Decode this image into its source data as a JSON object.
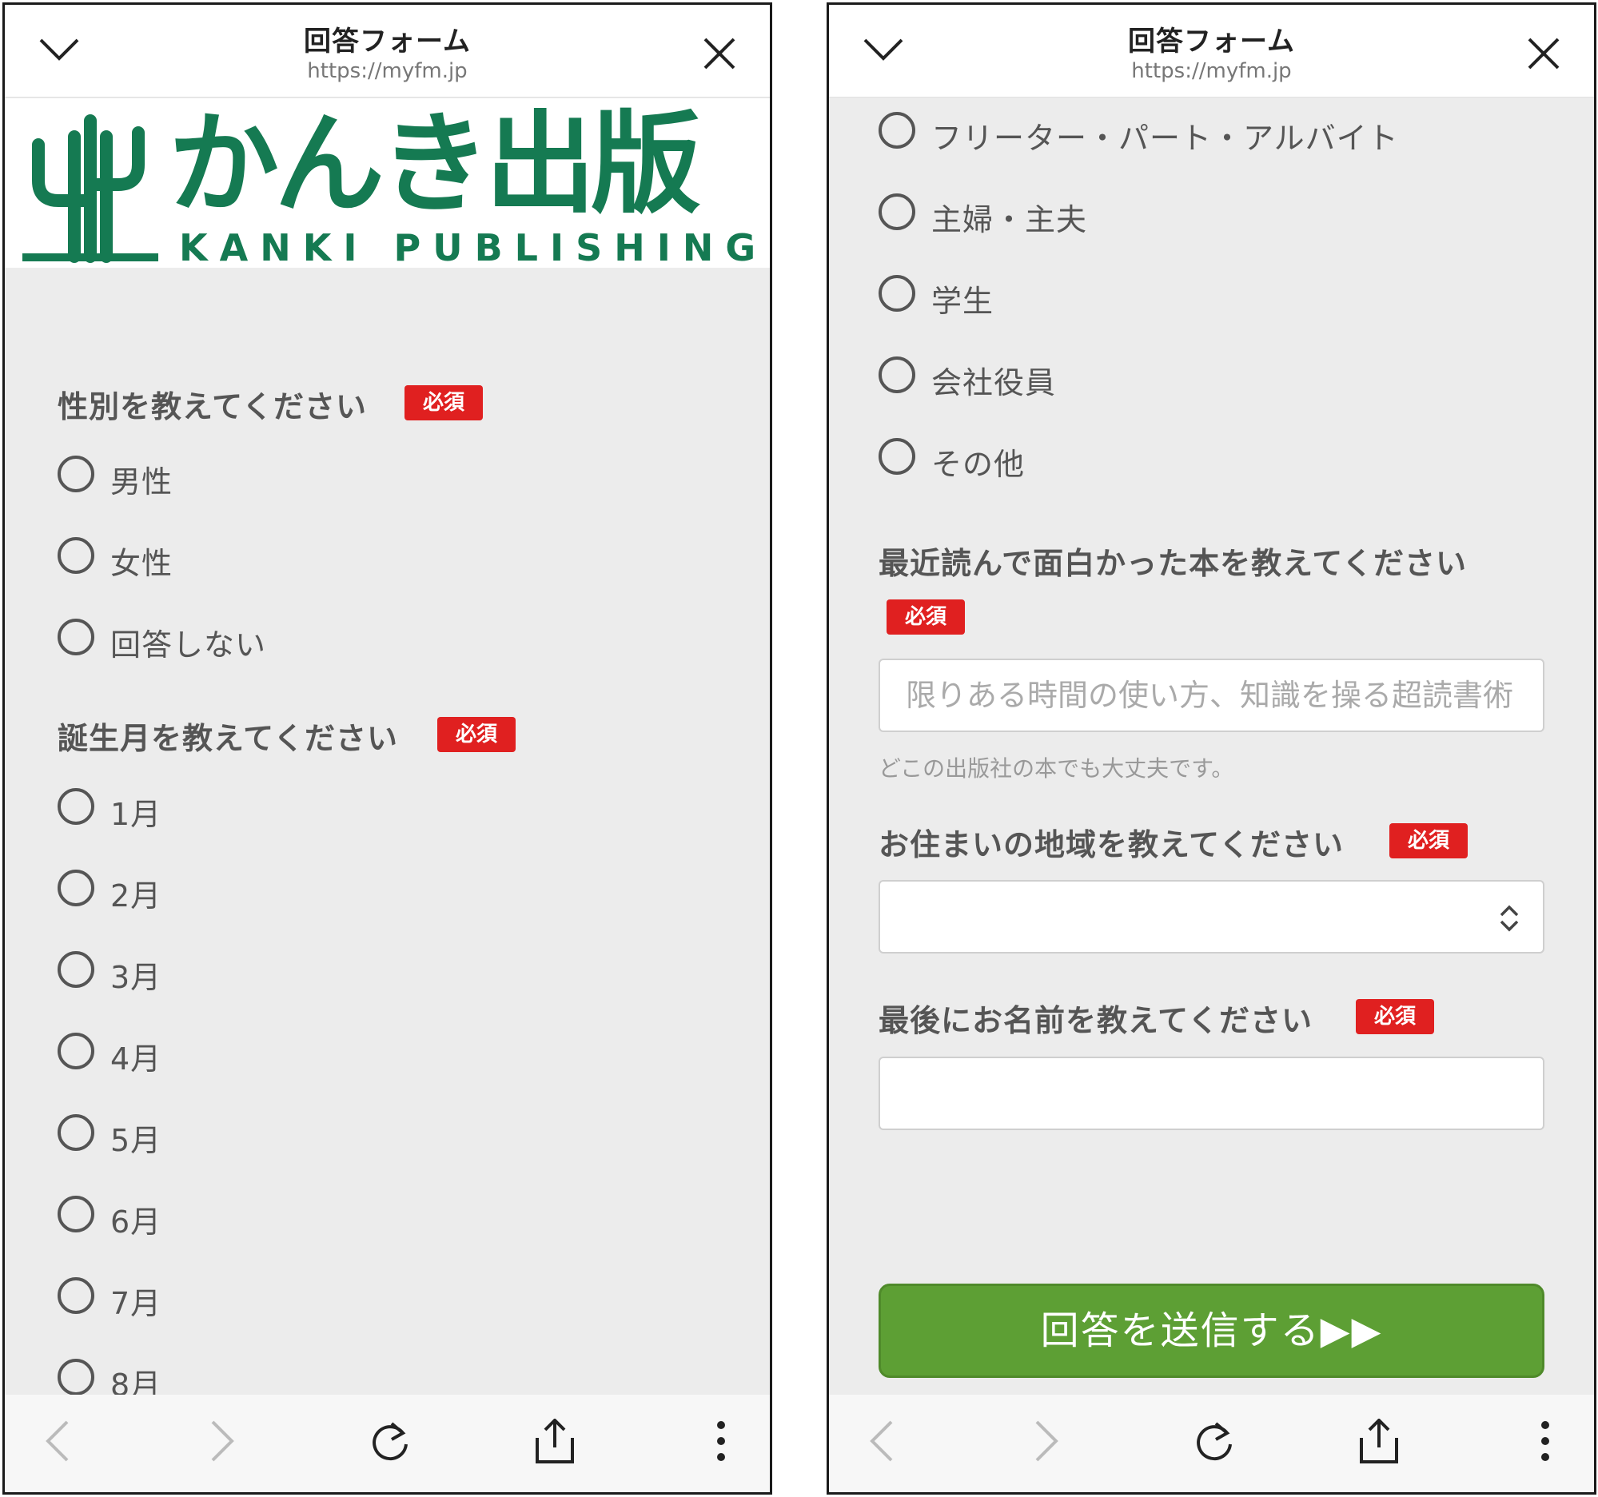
{
  "browser": {
    "title": "回答フォーム",
    "url": "https://myfm.jp"
  },
  "brand": {
    "logo_text": "かんき出版",
    "logo_sub": "KANKI PUBLISHING",
    "color": "#157a52"
  },
  "required_badge": "必須",
  "accent_colors": {
    "required": "#e02020",
    "submit": "#5d9f34"
  },
  "left": {
    "gender": {
      "label": "性別を教えてください",
      "options": [
        "男性",
        "女性",
        "回答しない"
      ]
    },
    "birth_month": {
      "label": "誕生月を教えてください",
      "options": [
        "1月",
        "2月",
        "3月",
        "4月",
        "5月",
        "6月",
        "7月",
        "8月"
      ]
    }
  },
  "right": {
    "occupation_options": [
      "フリーター・パート・アルバイト",
      "主婦・主夫",
      "学生",
      "会社役員",
      "その他"
    ],
    "book": {
      "label": "最近読んで面白かった本を教えてください",
      "placeholder": "限りある時間の使い方、知識を操る超読書術",
      "hint": "どこの出版社の本でも大丈夫です。"
    },
    "region": {
      "label": "お住まいの地域を教えてください",
      "value": ""
    },
    "name": {
      "label": "最後にお名前を教えてください",
      "value": ""
    },
    "submit_label": "回答を送信する▶▶"
  },
  "icons": [
    "chevron-down-icon",
    "close-icon",
    "back-icon",
    "forward-icon",
    "reload-icon",
    "share-icon",
    "more-icon",
    "select-updown-icon",
    "cactus-logo-icon"
  ]
}
